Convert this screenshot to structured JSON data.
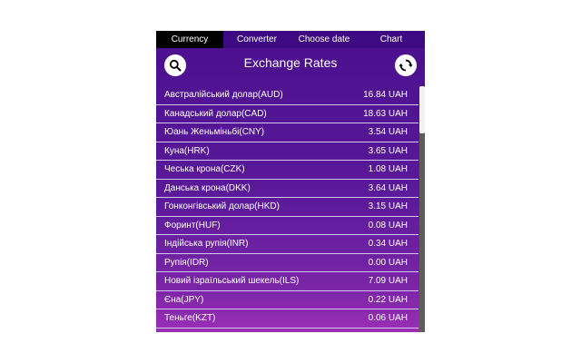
{
  "tabs": [
    {
      "label": "Currency",
      "active": true
    },
    {
      "label": "Converter",
      "active": false
    },
    {
      "label": "Choose date",
      "active": false
    },
    {
      "label": "Chart",
      "active": false
    }
  ],
  "header": {
    "title": "Exchange Rates",
    "search_icon": "search-icon",
    "refresh_icon": "refresh-icon"
  },
  "rates": [
    {
      "name": "Австралійський долар(AUD)",
      "value": "16.84 UAH"
    },
    {
      "name": "Канадський долар(CAD)",
      "value": "18.63 UAH"
    },
    {
      "name": "Юань Женьміньбі(CNY)",
      "value": "3.54 UAH"
    },
    {
      "name": "Куна(HRK)",
      "value": "3.65 UAH"
    },
    {
      "name": "Чеська крона(CZK)",
      "value": "1.08 UAH"
    },
    {
      "name": "Данська крона(DKK)",
      "value": "3.64 UAH"
    },
    {
      "name": "Гонконгівський долар(HKD)",
      "value": "3.15 UAH"
    },
    {
      "name": "Форинт(HUF)",
      "value": "0.08 UAH"
    },
    {
      "name": "Індійська рупія(INR)",
      "value": "0.34 UAH"
    },
    {
      "name": "Рупія(IDR)",
      "value": "0.00 UAH"
    },
    {
      "name": "Новий ізраїльський шекель(ILS)",
      "value": "7.09 UAH"
    },
    {
      "name": "Єна(JPY)",
      "value": "0.22 UAH"
    },
    {
      "name": "Теньге(KZT)",
      "value": "0.06 UAH"
    }
  ],
  "colors": {
    "panel_top": "#4a0f8e",
    "panel_bottom": "#9a2fb5",
    "active_tab": "#000000"
  }
}
